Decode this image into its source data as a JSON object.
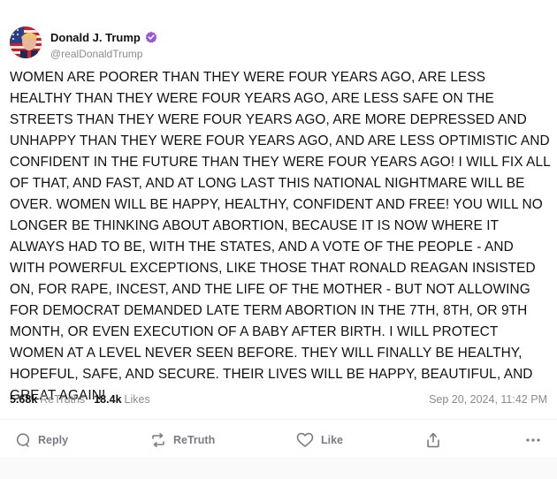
{
  "author": {
    "display_name": "Donald J. Trump",
    "handle": "@realDonaldTrump",
    "verified_icon": "verified-badge-icon",
    "verified_color": "#9b59d6"
  },
  "post": {
    "text": "WOMEN ARE POORER THAN THEY WERE FOUR YEARS AGO, ARE LESS HEALTHY THAN THEY WERE FOUR YEARS AGO, ARE LESS SAFE ON THE STREETS THAN THEY WERE FOUR YEARS AGO, ARE MORE DEPRESSED AND UNHAPPY THAN THEY WERE FOUR YEARS AGO, AND ARE LESS OPTIMISTIC AND CONFIDENT IN THE FUTURE THAN THEY WERE FOUR YEARS AGO! I WILL FIX ALL OF THAT, AND FAST, AND AT LONG LAST THIS NATIONAL NIGHTMARE WILL BE OVER. WOMEN WILL BE HAPPY, HEALTHY, CONFIDENT AND FREE! YOU WILL NO LONGER BE THINKING ABOUT ABORTION, BECAUSE IT IS NOW WHERE IT ALWAYS HAD TO BE, WITH THE STATES, AND A VOTE OF THE PEOPLE - AND WITH POWERFUL EXCEPTIONS, LIKE THOSE THAT RONALD REAGAN INSISTED ON, FOR RAPE, INCEST, AND THE LIFE OF THE MOTHER - BUT NOT ALLOWING FOR DEMOCRAT DEMANDED LATE TERM ABORTION IN THE 7TH, 8TH, OR 9TH MONTH, OR EVEN EXECUTION OF A BABY AFTER BIRTH. I WILL PROTECT WOMEN AT A LEVEL NEVER SEEN BEFORE. THEY WILL FINALLY BE HEALTHY, HOPEFUL, SAFE, AND SECURE. THEIR LIVES WILL BE HAPPY, BEAUTIFUL, AND GREAT AGAIN!",
    "timestamp": "Sep 20, 2024, 11:42 PM"
  },
  "stats": {
    "retruths_count": "5.68k",
    "retruths_label": "ReTruths",
    "likes_count": "18.4k",
    "likes_label": "Likes"
  },
  "actions": {
    "reply_label": "Reply",
    "retruth_label": "ReTruth",
    "like_label": "Like"
  },
  "colors": {
    "text": "#111111",
    "muted": "#8a8a94",
    "action": "#7b7b86"
  }
}
